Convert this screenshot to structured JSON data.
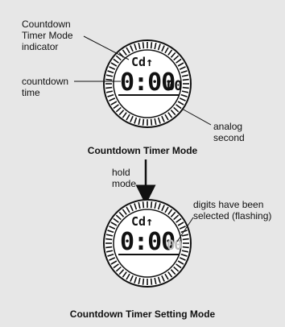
{
  "colors": {
    "background": "#e7e7e7",
    "ink": "#111111",
    "flash_digits": "#bbbbbb"
  },
  "watch_top": {
    "mode_indicator": "Cd↑",
    "time_main": "0:00",
    "time_small": "00",
    "label_mode_indicator": "Countdown\nTimer Mode\nindicator",
    "label_countdown_time": "countdown\ntime",
    "label_analog_second": "analog\nsecond",
    "caption": "Countdown Timer Mode"
  },
  "transition": {
    "label": "hold\nmode"
  },
  "watch_bottom": {
    "mode_indicator": "Cd↑",
    "time_main": "0:00",
    "time_small": "00",
    "label_flashing": "digits have been\nselected (flashing)",
    "caption": "Countdown Timer Setting Mode"
  }
}
